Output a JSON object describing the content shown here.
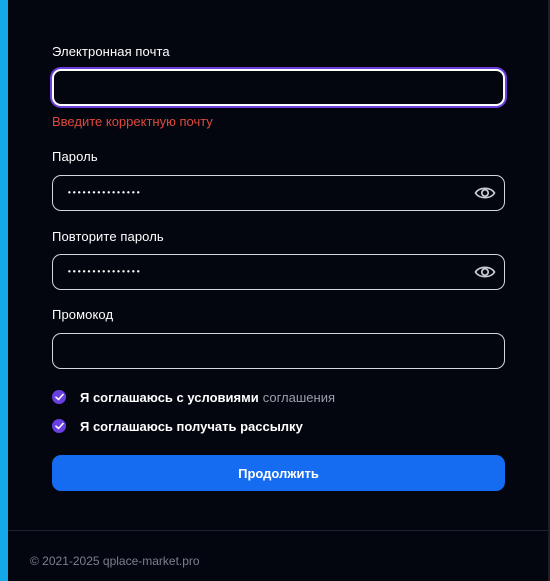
{
  "form": {
    "email_label": "Электронная почта",
    "email_value": "",
    "email_error": "Введите корректную почту",
    "password_label": "Пароль",
    "password_mask": "•••••••••••••••",
    "confirm_label": "Повторите пароль",
    "confirm_mask": "•••••••••••••••",
    "promo_label": "Промокод",
    "promo_value": "",
    "agree_terms_text": "Я соглашаюсь с условиями",
    "agree_terms_link": "соглашения",
    "agree_terms_checked": true,
    "agree_newsletter_text": "Я соглашаюсь получать рассылку",
    "agree_newsletter_checked": true,
    "submit_label": "Продолжить"
  },
  "footer": {
    "copyright": "© 2021-2025 qplace-market.pro"
  },
  "colors": {
    "background": "#03060f",
    "accent_blue": "#166cf0",
    "checkbox_purple": "#6a3fe0",
    "error_red": "#e0483c",
    "focus_ring": "#6d3ee0"
  },
  "icons": {
    "password_toggle": "eye-icon",
    "checkbox_mark": "checkmark-icon"
  }
}
